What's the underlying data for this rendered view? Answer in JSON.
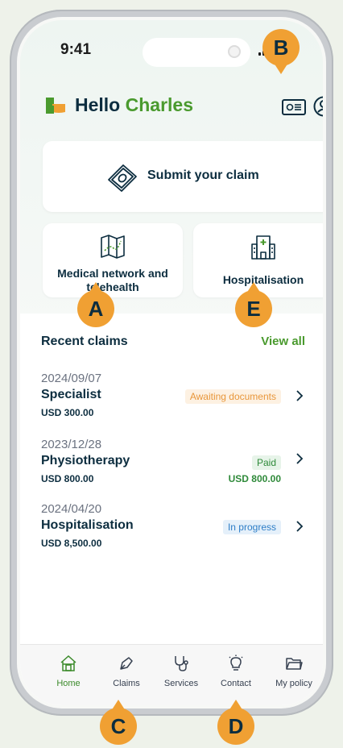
{
  "status_bar": {
    "time": "9:41"
  },
  "header": {
    "greeting": "Hello",
    "name": "Charles"
  },
  "tiles": {
    "submit_claim": "Submit your claim",
    "medical_network": "Medical network and telehealth",
    "hospitalisation": "Hospitalisation"
  },
  "recent": {
    "title": "Recent claims",
    "view_all": "View all",
    "claims": [
      {
        "date": "2024/09/07",
        "type": "Specialist",
        "amount": "USD 300.00",
        "status": "Awaiting documents",
        "paid_amount": ""
      },
      {
        "date": "2023/12/28",
        "type": "Physiotherapy",
        "amount": "USD 800.00",
        "status": "Paid",
        "paid_amount": "USD 800.00"
      },
      {
        "date": "2024/04/20",
        "type": "Hospitalisation",
        "amount": "USD 8,500.00",
        "status": "In progress",
        "paid_amount": ""
      }
    ]
  },
  "nav": {
    "items": [
      {
        "label": "Home",
        "icon": "home-icon"
      },
      {
        "label": "Claims",
        "icon": "pen-icon"
      },
      {
        "label": "Services",
        "icon": "stethoscope-icon"
      },
      {
        "label": "Contact",
        "icon": "lightbulb-icon"
      },
      {
        "label": "My policy",
        "icon": "folder-icon"
      }
    ]
  },
  "markers": {
    "a": "A",
    "b": "B",
    "c": "C",
    "d": "D",
    "e": "E"
  },
  "colors": {
    "brand_green": "#4a9a2e",
    "navy": "#0c2d3f",
    "marker": "#f0a033"
  }
}
